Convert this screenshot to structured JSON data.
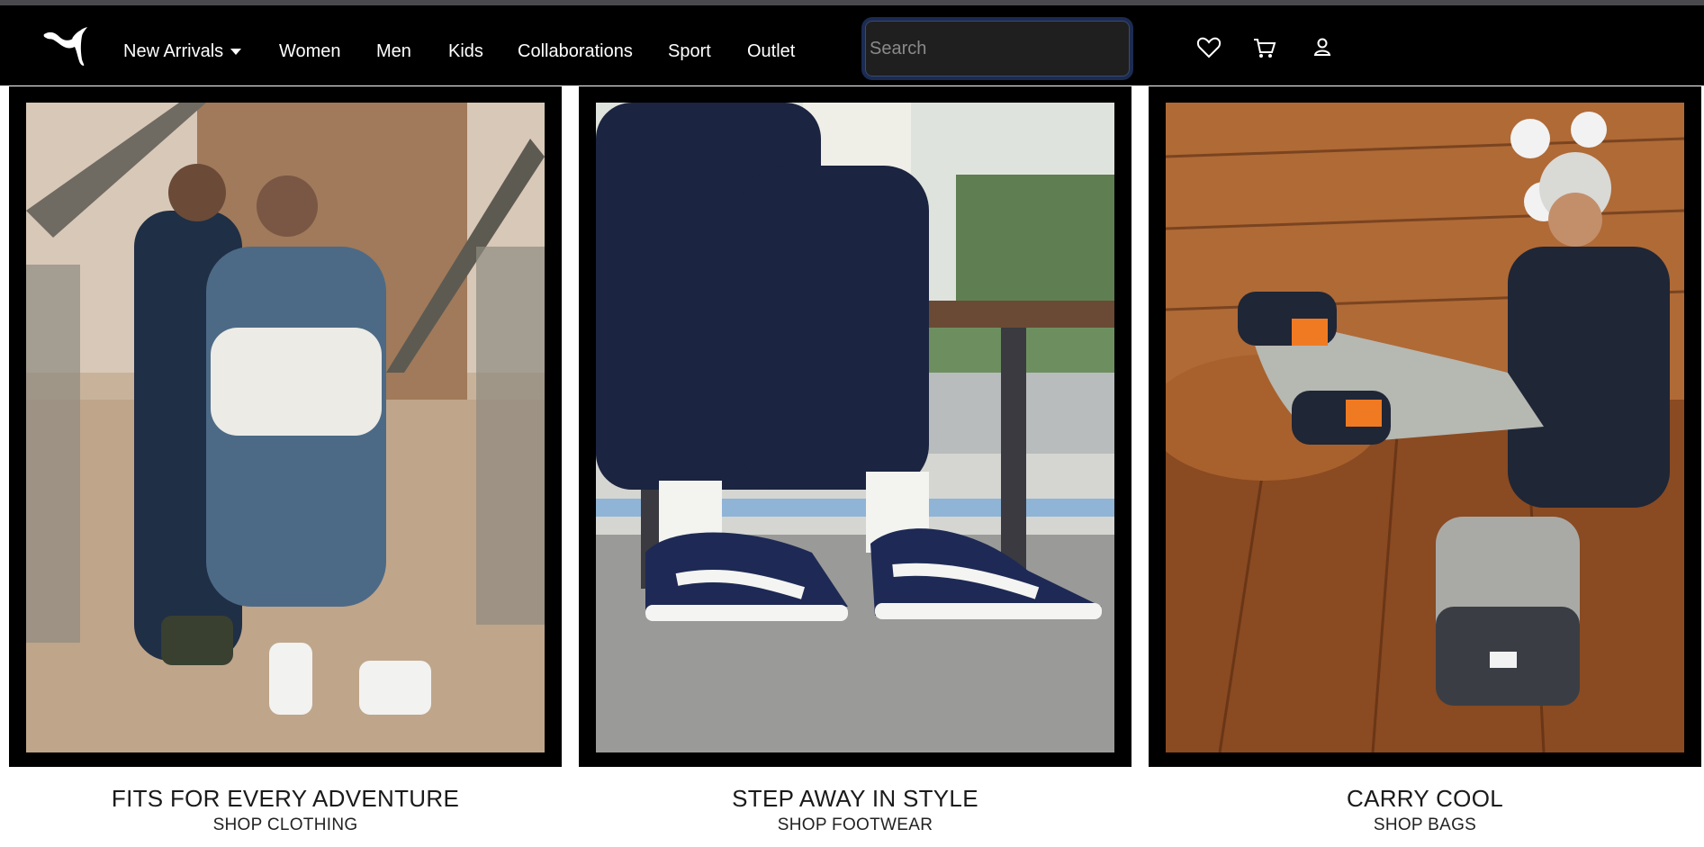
{
  "nav": {
    "logo_icon": "puma-cat-logo-icon",
    "items": [
      {
        "label": "New Arrivals",
        "has_dropdown": true
      },
      {
        "label": "Women"
      },
      {
        "label": "Men"
      },
      {
        "label": "Kids"
      },
      {
        "label": "Collaborations"
      },
      {
        "label": "Sport"
      },
      {
        "label": "Outlet"
      }
    ],
    "search": {
      "placeholder": "Search",
      "value": ""
    },
    "icons": [
      "heart-icon",
      "cart-icon",
      "user-icon"
    ]
  },
  "tiles": [
    {
      "title": "FITS FOR EVERY ADVENTURE",
      "link": "SHOP CLOTHING"
    },
    {
      "title": "STEP AWAY IN STYLE",
      "link": "SHOP FOOTWEAR"
    },
    {
      "title": "CARRY COOL",
      "link": "SHOP BAGS"
    }
  ],
  "colors": {
    "nav_bg": "#000000",
    "search_focus_ring": "#1b2b52",
    "tile_frame": "#000000"
  }
}
